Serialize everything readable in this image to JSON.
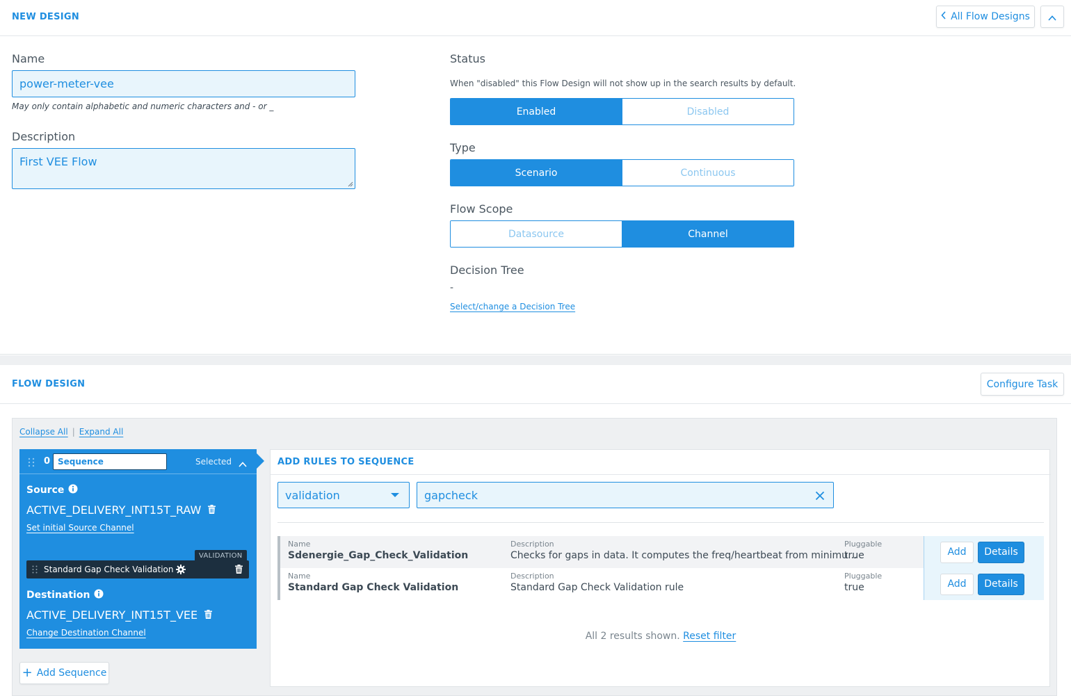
{
  "top": {
    "title": "NEW DESIGN",
    "all_designs_label": "All Flow Designs",
    "name_label": "Name",
    "name_value": "power-meter-vee",
    "name_hint": "May only contain alphabetic and numeric characters and - or _",
    "description_label": "Description",
    "description_value": "First VEE Flow",
    "status_label": "Status",
    "status_hint": "When \"disabled\" this Flow Design will not show up in the search results by default.",
    "status_options": [
      "Enabled",
      "Disabled"
    ],
    "status_selected": "Enabled",
    "type_label": "Type",
    "type_options": [
      "Scenario",
      "Continuous"
    ],
    "type_selected": "Scenario",
    "scope_label": "Flow Scope",
    "scope_options": [
      "Datasource",
      "Channel"
    ],
    "scope_selected": "Channel",
    "tree_label": "Decision Tree",
    "tree_value": "-",
    "tree_link": "Select/change a Decision Tree"
  },
  "flow": {
    "title": "FLOW DESIGN",
    "configure_label": "Configure Task",
    "collapse_all": "Collapse All",
    "separator": "|",
    "expand_all": "Expand All",
    "add_sequence": "Add Sequence",
    "add_sequence_prefix": "+",
    "sequence": {
      "index": "0",
      "name": "Sequence",
      "status": "Selected",
      "source_label": "Source",
      "source_channel": "ACTIVE_DELIVERY_INT15T_RAW",
      "source_link": "Set initial Source Channel",
      "rule_tag": "VALIDATION",
      "rule_name": "Standard Gap Check Validation",
      "destination_label": "Destination",
      "destination_channel": "ACTIVE_DELIVERY_INT15T_VEE",
      "destination_link": "Change Destination Channel"
    }
  },
  "rules": {
    "title": "ADD RULES TO SEQUENCE",
    "type_filter": "validation",
    "search_value": "gapcheck",
    "col_name": "Name",
    "col_description": "Description",
    "col_pluggable": "Pluggable",
    "add_label": "Add",
    "details_label": "Details",
    "rows": [
      {
        "name": "Sdenergie_Gap_Check_Validation",
        "description": "Checks for gaps in data. It computes the freq/heartbeat from minimu...",
        "pluggable": "true"
      },
      {
        "name": "Standard Gap Check Validation",
        "description": "Standard Gap Check Validation rule",
        "pluggable": "true"
      }
    ],
    "summary": "All 2 results shown.",
    "reset_label": "Reset filter"
  },
  "colors": {
    "accent": "#1f8ee0",
    "input_bg": "#e8f5fc",
    "dark_chip": "#1c2f3f"
  },
  "icons": [
    "chevron-left-icon",
    "chevron-up-icon",
    "info-icon",
    "trash-icon",
    "gear-icon",
    "drag-handle-icon",
    "caret-down-icon",
    "clear-icon"
  ]
}
